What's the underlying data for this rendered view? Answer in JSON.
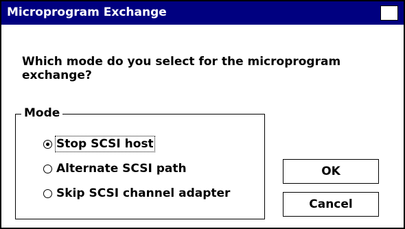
{
  "window": {
    "title": "Microprogram Exchange",
    "title_bar_color": "#000080"
  },
  "prompt": {
    "text": "Which mode do you select for the microprogram exchange?"
  },
  "mode_group": {
    "label": "Mode",
    "options": [
      {
        "label": "Stop SCSI host",
        "selected": true
      },
      {
        "label": "Alternate SCSI path",
        "selected": false
      },
      {
        "label": "Skip SCSI channel adapter",
        "selected": false
      }
    ]
  },
  "buttons": {
    "ok_label": "OK",
    "cancel_label": "Cancel"
  }
}
